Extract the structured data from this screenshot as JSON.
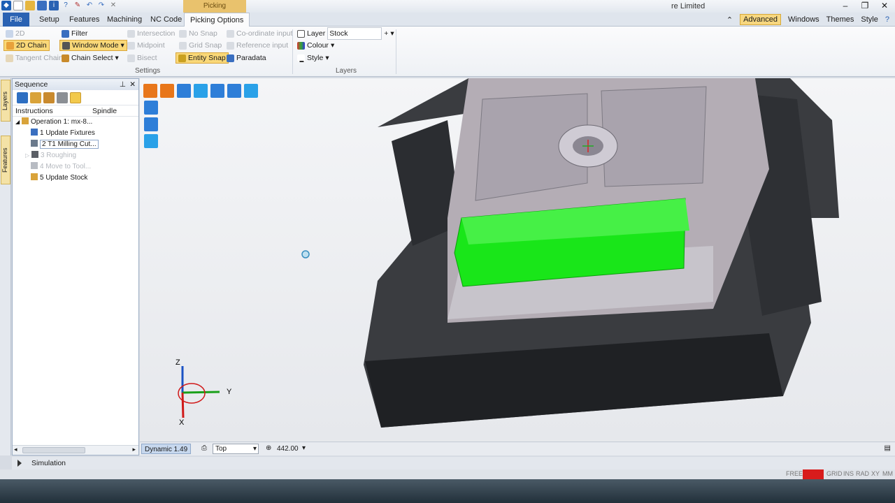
{
  "titlebar": {
    "context_title": "Picking",
    "app_title": "re Limited",
    "controls": [
      "–",
      "❐",
      "✕"
    ]
  },
  "tabs": {
    "file": "File",
    "items": [
      "Setup",
      "Features",
      "Machining",
      "NC Code"
    ],
    "active": "Picking Options",
    "right": {
      "advanced": "Advanced",
      "windows": "Windows",
      "themes": "Themes",
      "style": "Style"
    }
  },
  "ribbon": {
    "col1": [
      "2D",
      "2D Chain",
      "Tangent Chain"
    ],
    "col2": [
      "Filter",
      "Window Mode",
      "Chain Select"
    ],
    "col3": [
      "Intersection",
      "Midpoint",
      "Bisect"
    ],
    "col4": [
      "No Snap",
      "Grid Snap",
      "Entity Snap"
    ],
    "col5": [
      "Co-ordinate input",
      "Reference input",
      "Paradata"
    ],
    "settings_label": "Settings",
    "layers": {
      "layer_label": "Layer",
      "layer_value": "Stock",
      "colour": "Colour",
      "style": "Style"
    },
    "layers_label": "Layers"
  },
  "side_tabs": {
    "layers": "Layers",
    "features": "Features"
  },
  "sequence": {
    "title": "Sequence",
    "col_instructions": "Instructions",
    "col_spindle": "Spindle",
    "rows": [
      "Operation 1: mx-8...",
      "1 Update Fixtures",
      "2 T1 Milling Cut...",
      "3 Roughing",
      "4 Move to Tool...",
      "5 Update Stock"
    ]
  },
  "triad": {
    "z": "Z",
    "y": "Y",
    "x": "X"
  },
  "viewport_status": {
    "dynamic": "Dynamic 1.49",
    "view": "Top",
    "zoom": "442.00"
  },
  "simulation": {
    "label": "Simulation"
  },
  "statusbar": {
    "items": [
      "FREE",
      "GRID",
      "INS",
      "RAD",
      "XY",
      "MM"
    ]
  },
  "colors": {
    "accent": "#2a62b3",
    "highlight": "#f9d878",
    "selected_part": "#19e619",
    "context_tab": "#e9c26d"
  }
}
